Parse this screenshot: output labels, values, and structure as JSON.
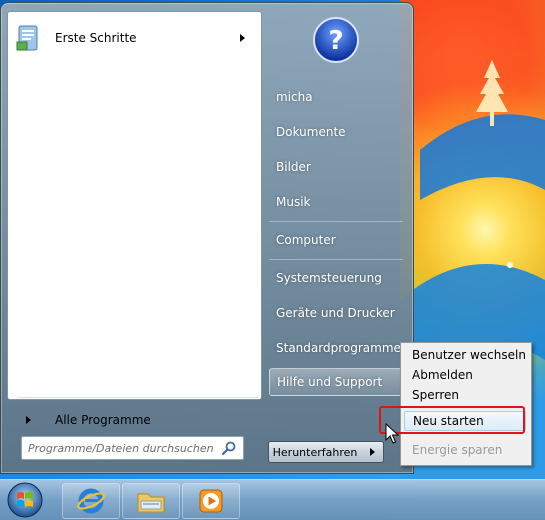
{
  "left_pane": {
    "items": [
      {
        "label": "Erste Schritte",
        "icon": "getting-started-icon",
        "has_submenu": true
      }
    ],
    "all_programs_label": "Alle Programme",
    "search": {
      "placeholder": "Programme/Dateien durchsuchen",
      "value": ""
    }
  },
  "right_pane": {
    "items": [
      {
        "label": "micha"
      },
      {
        "label": "Dokumente"
      },
      {
        "label": "Bilder"
      },
      {
        "label": "Musik"
      },
      {
        "label": "Computer"
      },
      {
        "label": "Systemsteuerung"
      },
      {
        "label": "Geräte und Drucker"
      },
      {
        "label": "Standardprogramme"
      },
      {
        "label": "Hilfe und Support"
      }
    ],
    "shutdown_label": "Herunterfahren"
  },
  "context_menu": {
    "items": [
      {
        "label": "Benutzer wechseln",
        "enabled": true
      },
      {
        "label": "Abmelden",
        "enabled": true
      },
      {
        "label": "Sperren",
        "enabled": true
      },
      {
        "label": "Neu starten",
        "enabled": true,
        "highlighted": true
      },
      {
        "label": "Energie sparen",
        "enabled": false
      }
    ]
  },
  "taskbar": {
    "apps": [
      {
        "icon": "internet-explorer-icon"
      },
      {
        "icon": "windows-explorer-icon"
      },
      {
        "icon": "media-player-icon"
      }
    ]
  },
  "colors": {
    "highlight_border": "#e0121a",
    "menu_hover": "#dcebf8"
  }
}
